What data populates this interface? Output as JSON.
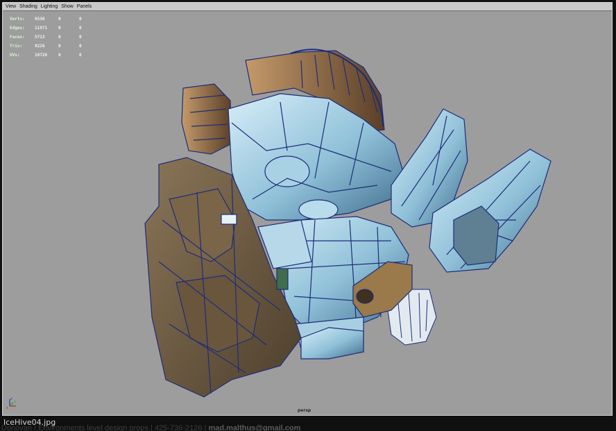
{
  "menu": {
    "items": [
      "View",
      "Shading",
      "Lighting",
      "Show",
      "Panels"
    ]
  },
  "hud": {
    "rows": [
      {
        "label": "Verts:",
        "value": "6536",
        "col2": "0",
        "col3": "0"
      },
      {
        "label": "Edges:",
        "value": "11971",
        "col2": "0",
        "col3": "0"
      },
      {
        "label": "Faces:",
        "value": "5713",
        "col2": "0",
        "col3": "0"
      },
      {
        "label": "Tris:",
        "value": "9226",
        "col2": "0",
        "col3": "0"
      },
      {
        "label": "UVs:",
        "value": "10726",
        "col2": "0",
        "col3": "0"
      }
    ]
  },
  "viewport": {
    "camera_label": "persp",
    "axis_labels": {
      "x": "x",
      "y": "y",
      "z": "z"
    }
  },
  "caption": "IceHive04.jpg",
  "footer": {
    "text": "Donovan  |  Environments  level design  props  |  425-736-2126  |",
    "email": "mad.malthus@gmail.com"
  },
  "colors": {
    "viewport_bg": "#9d9d9d",
    "ice_blue": "#8fc0d8",
    "wireframe": "#1d2c7a",
    "stone_brown": "#6e5a3e"
  }
}
